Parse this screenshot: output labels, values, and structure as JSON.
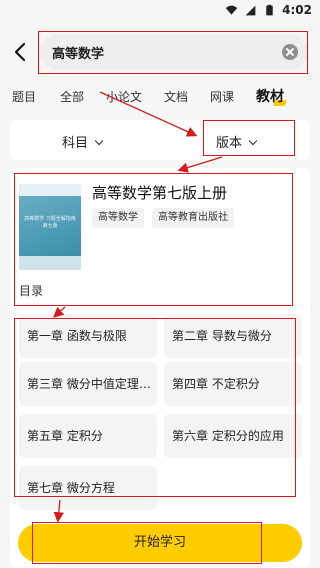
{
  "statusbar": {
    "time": "4:02"
  },
  "search": {
    "query": "高等数学"
  },
  "tabs": [
    "题目",
    "全部",
    "小论文",
    "文档",
    "网课",
    "教材"
  ],
  "filters": {
    "subject": "科目",
    "edition": "版本"
  },
  "book": {
    "title": "高等数学第七版上册",
    "tags": [
      "高等数学",
      "高等教育出版社"
    ],
    "cover_text": "高等数学 习题全解指南 第七版"
  },
  "toc": {
    "label": "目录",
    "chapters": [
      "第一章 函数与极限",
      "第二章 导数与微分",
      "第三章 微分中值定理…",
      "第四章 不定积分",
      "第五章 定积分",
      "第六章 定积分的应用",
      "第七章 微分方程"
    ]
  },
  "actions": {
    "start": "开始学习"
  },
  "colors": {
    "accent": "#ffcc00",
    "annotation": "#d51a1a"
  }
}
